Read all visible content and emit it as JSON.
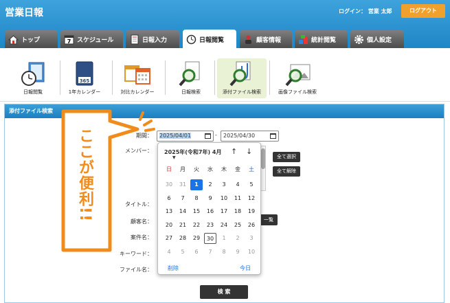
{
  "header": {
    "title": "営業日報",
    "login_label": "ログイン：",
    "login_user": "営業 太郎",
    "logout": "ログアウト"
  },
  "tabs": [
    {
      "label": "トップ",
      "icon": "home-icon"
    },
    {
      "label": "スケジュール",
      "icon": "calendar-icon"
    },
    {
      "label": "日報入力",
      "icon": "document-icon"
    },
    {
      "label": "日報閲覧",
      "icon": "clock-icon",
      "active": true
    },
    {
      "label": "顧客情報",
      "icon": "customer-icon"
    },
    {
      "label": "統計閲覧",
      "icon": "stats-icon"
    },
    {
      "label": "個人設定",
      "icon": "gear-icon"
    }
  ],
  "subnav": [
    {
      "label": "日報閲覧"
    },
    {
      "label": "1年カレンダー",
      "badge": "365"
    },
    {
      "label": "対比カレンダー"
    },
    {
      "label": "日報検索"
    },
    {
      "label": "添付ファイル検索",
      "active": true
    },
    {
      "label": "画像ファイル検索"
    }
  ],
  "panel": {
    "title": "添付ファイル検索"
  },
  "form": {
    "period_label": "期間：",
    "date_from": "2025/04/01",
    "date_sep": "-",
    "date_to": "2025/04/30",
    "member_label": "メンバー：",
    "select_all": "全て選択",
    "clear_all": "全て解除",
    "title_label": "タイトル：",
    "customer_label": "顧客名：",
    "customer_btn": "一覧",
    "project_label": "案件名：",
    "keyword_label": "キーワード：",
    "file_label": "ファイル名：",
    "search": "検 索"
  },
  "calendar": {
    "title": "2025年(令和7年) 4月",
    "weekdays": [
      "日",
      "月",
      "火",
      "水",
      "木",
      "金",
      "土"
    ],
    "weeks": [
      [
        "30",
        "31",
        "1",
        "2",
        "3",
        "4",
        "5"
      ],
      [
        "6",
        "7",
        "8",
        "9",
        "10",
        "11",
        "12"
      ],
      [
        "13",
        "14",
        "15",
        "16",
        "17",
        "18",
        "19"
      ],
      [
        "20",
        "21",
        "22",
        "23",
        "24",
        "25",
        "26"
      ],
      [
        "27",
        "28",
        "29",
        "30",
        "1",
        "2",
        "3"
      ],
      [
        "4",
        "5",
        "6",
        "7",
        "8",
        "9",
        "10"
      ]
    ],
    "clear": "削除",
    "today": "今日"
  },
  "callout": {
    "text": "ここが便利!!"
  },
  "colors": {
    "accent": "#1f86c6",
    "orange": "#f08c1c",
    "selected": "#1a73e8"
  }
}
